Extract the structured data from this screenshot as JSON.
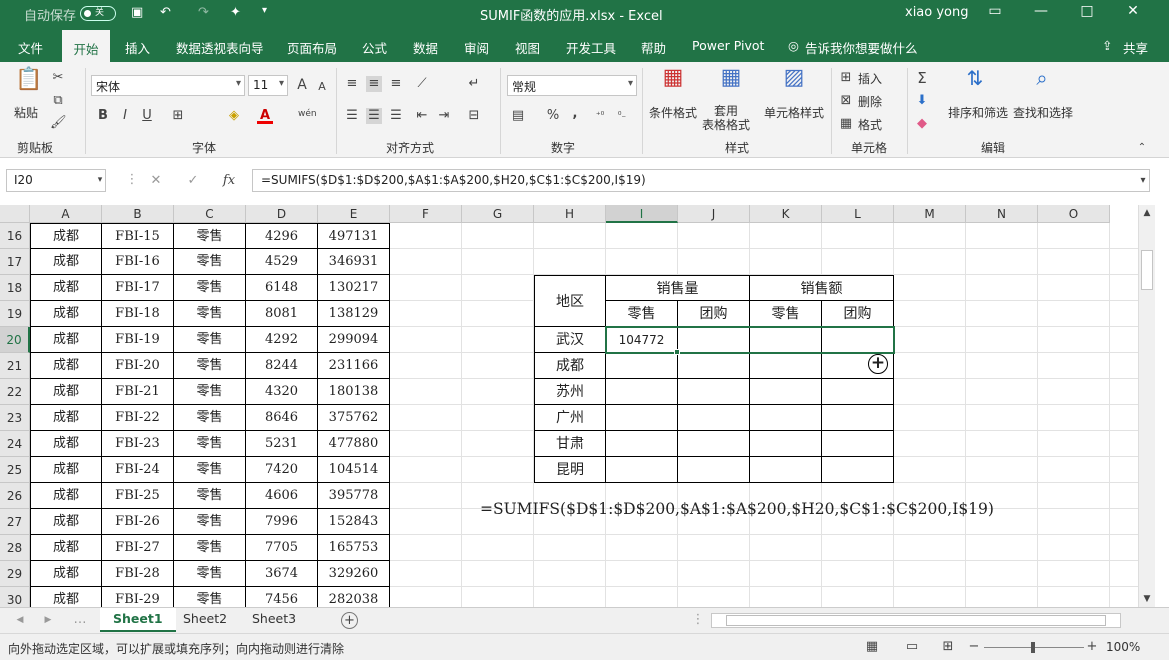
{
  "title_bar": {
    "autosave_label": "自动保存",
    "autosave_state": "关",
    "title": "SUMIF函数的应用.xlsx  -  Excel",
    "user": "xiao yong",
    "minimize": "—",
    "restore": "□",
    "close": "✕",
    "ribbon_display": "▭"
  },
  "menu": {
    "items": [
      "文件",
      "开始",
      "插入",
      "数据透视表向导",
      "页面布局",
      "公式",
      "数据",
      "审阅",
      "视图",
      "开发工具",
      "帮助",
      "Power Pivot"
    ],
    "tell_me": "告诉我你想要做什么",
    "share": "共享"
  },
  "ribbon": {
    "clipboard": {
      "label": "剪贴板",
      "paste": "粘贴"
    },
    "font": {
      "label": "字体",
      "name": "宋体",
      "size": "11",
      "bold": "B",
      "italic": "I",
      "underline": "U",
      "grow": "A",
      "shrink": "A",
      "wen": "wén"
    },
    "alignment": {
      "label": "对齐方式"
    },
    "number": {
      "label": "数字",
      "format": "常规",
      "percent": "%",
      "comma": ","
    },
    "styles": {
      "label": "样式",
      "cond_format": "条件格式",
      "table_format": "套用\n表格格式",
      "cell_style": "单元格样式"
    },
    "cells": {
      "label": "单元格",
      "insert": "插入",
      "delete": "删除",
      "format": "格式"
    },
    "editing": {
      "label": "编辑",
      "sort": "排序和筛选",
      "find": "查找和选择"
    }
  },
  "formula_bar": {
    "name_box": "I20",
    "cancel": "✕",
    "enter": "✓",
    "fx": "fx",
    "formula": "=SUMIFS($D$1:$D$200,$A$1:$A$200,$H20,$C$1:$C$200,I$19)"
  },
  "columns": [
    "A",
    "B",
    "C",
    "D",
    "E",
    "F",
    "G",
    "H",
    "I",
    "J",
    "K",
    "L",
    "M",
    "N",
    "O"
  ],
  "rows": [
    {
      "num": "16",
      "a": "成都",
      "b": "FBI-15",
      "c": "零售",
      "d": "4296",
      "e": "497131"
    },
    {
      "num": "17",
      "a": "成都",
      "b": "FBI-16",
      "c": "零售",
      "d": "4529",
      "e": "346931"
    },
    {
      "num": "18",
      "a": "成都",
      "b": "FBI-17",
      "c": "零售",
      "d": "6148",
      "e": "130217"
    },
    {
      "num": "19",
      "a": "成都",
      "b": "FBI-18",
      "c": "零售",
      "d": "8081",
      "e": "138129"
    },
    {
      "num": "20",
      "a": "成都",
      "b": "FBI-19",
      "c": "零售",
      "d": "4292",
      "e": "299094"
    },
    {
      "num": "21",
      "a": "成都",
      "b": "FBI-20",
      "c": "零售",
      "d": "8244",
      "e": "231166"
    },
    {
      "num": "22",
      "a": "成都",
      "b": "FBI-21",
      "c": "零售",
      "d": "4320",
      "e": "180138"
    },
    {
      "num": "23",
      "a": "成都",
      "b": "FBI-22",
      "c": "零售",
      "d": "8646",
      "e": "375762"
    },
    {
      "num": "24",
      "a": "成都",
      "b": "FBI-23",
      "c": "零售",
      "d": "5231",
      "e": "477880"
    },
    {
      "num": "25",
      "a": "成都",
      "b": "FBI-24",
      "c": "零售",
      "d": "7420",
      "e": "104514"
    },
    {
      "num": "26",
      "a": "成都",
      "b": "FBI-25",
      "c": "零售",
      "d": "4606",
      "e": "395778"
    },
    {
      "num": "27",
      "a": "成都",
      "b": "FBI-26",
      "c": "零售",
      "d": "7996",
      "e": "152843"
    },
    {
      "num": "28",
      "a": "成都",
      "b": "FBI-27",
      "c": "零售",
      "d": "7705",
      "e": "165753"
    },
    {
      "num": "29",
      "a": "成都",
      "b": "FBI-28",
      "c": "零售",
      "d": "3674",
      "e": "329260"
    },
    {
      "num": "30",
      "a": "成都",
      "b": "FBI-29",
      "c": "零售",
      "d": "7456",
      "e": "282038"
    }
  ],
  "summary_table": {
    "region_header": "地区",
    "sales_qty": "销售量",
    "sales_amt": "销售额",
    "retail": "零售",
    "group": "团购",
    "regions": [
      "武汉",
      "成都",
      "苏州",
      "广州",
      "甘肃",
      "昆明"
    ],
    "i20_value": "104772"
  },
  "formula_note": "=SUMIFS($D$1:$D$200,$A$1:$A$200,$H20,$C$1:$C$200,I$19)",
  "sheets": [
    "Sheet1",
    "Sheet2",
    "Sheet3"
  ],
  "status": {
    "message": "向外拖动选定区域，可以扩展或填充序列；向内拖动则进行清除",
    "zoom": "100%",
    "zoom_out": "−",
    "zoom_in": "+"
  }
}
